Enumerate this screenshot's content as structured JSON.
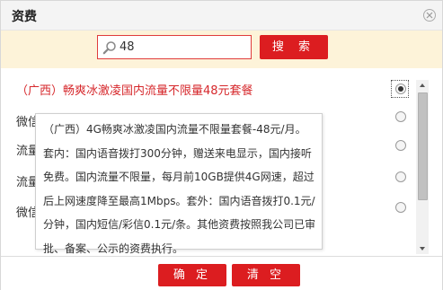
{
  "dialog": {
    "title": "资费"
  },
  "search": {
    "value": "48",
    "button_label": "搜 索"
  },
  "plans": [
    {
      "label": "（广西）畅爽冰激凌国内流量不限量48元套餐",
      "selected": true
    },
    {
      "label": "微信",
      "selected": false
    },
    {
      "label": "流量",
      "selected": false
    },
    {
      "label": "流量",
      "selected": false
    },
    {
      "label": "微信",
      "selected": false
    }
  ],
  "tooltip": {
    "text": "（广西）4G畅爽冰激凌国内流量不限量套餐-48元/月。套内：国内语音拨打300分钟，赠送来电显示，国内接听免费。国内流量不限量，每月前10GB提供4G网速，超过后上网速度降至最高1Mbps。套外：国内语音拨打0.1元/分钟，国内短信/彩信0.1元/条。其他资费按照我公司已审批、备案、公示的资费执行。"
  },
  "footer": {
    "confirm_label": "确 定",
    "clear_label": "清 空"
  },
  "colors": {
    "accent": "#dc1d20",
    "search_bg": "#fdf3d9",
    "selected_text": "#d6282c"
  }
}
